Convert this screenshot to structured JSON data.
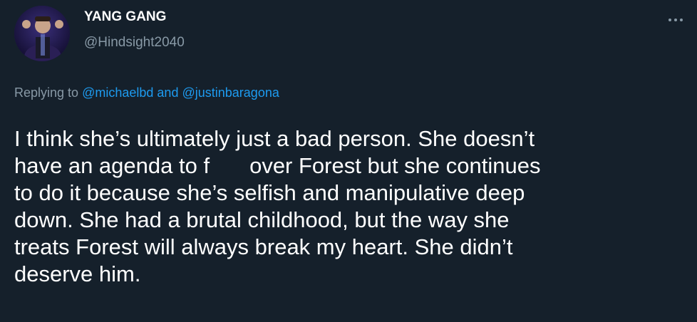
{
  "tweet": {
    "display_name": "YANG GANG",
    "handle": "@Hindsight2040",
    "more_icon": "ellipsis-icon",
    "replying_prefix": "Replying to",
    "mention_1": "@michaelbd",
    "replying_and": "and",
    "mention_2": "@justinbaragona",
    "body_lines": [
      "I think she’s ultimately just a bad person. She doesn’t",
      "have an agenda to f",
      "over Forest but she continues",
      "to do it because she’s selfish and manipulative deep",
      "down. She had a brutal childhood, but the way she",
      "treats Forest will always break my heart. She didn’t",
      "deserve him."
    ]
  },
  "colors": {
    "background": "#15202b",
    "text": "#ffffff",
    "secondary": "#8899a6",
    "link": "#1d9bf0"
  }
}
